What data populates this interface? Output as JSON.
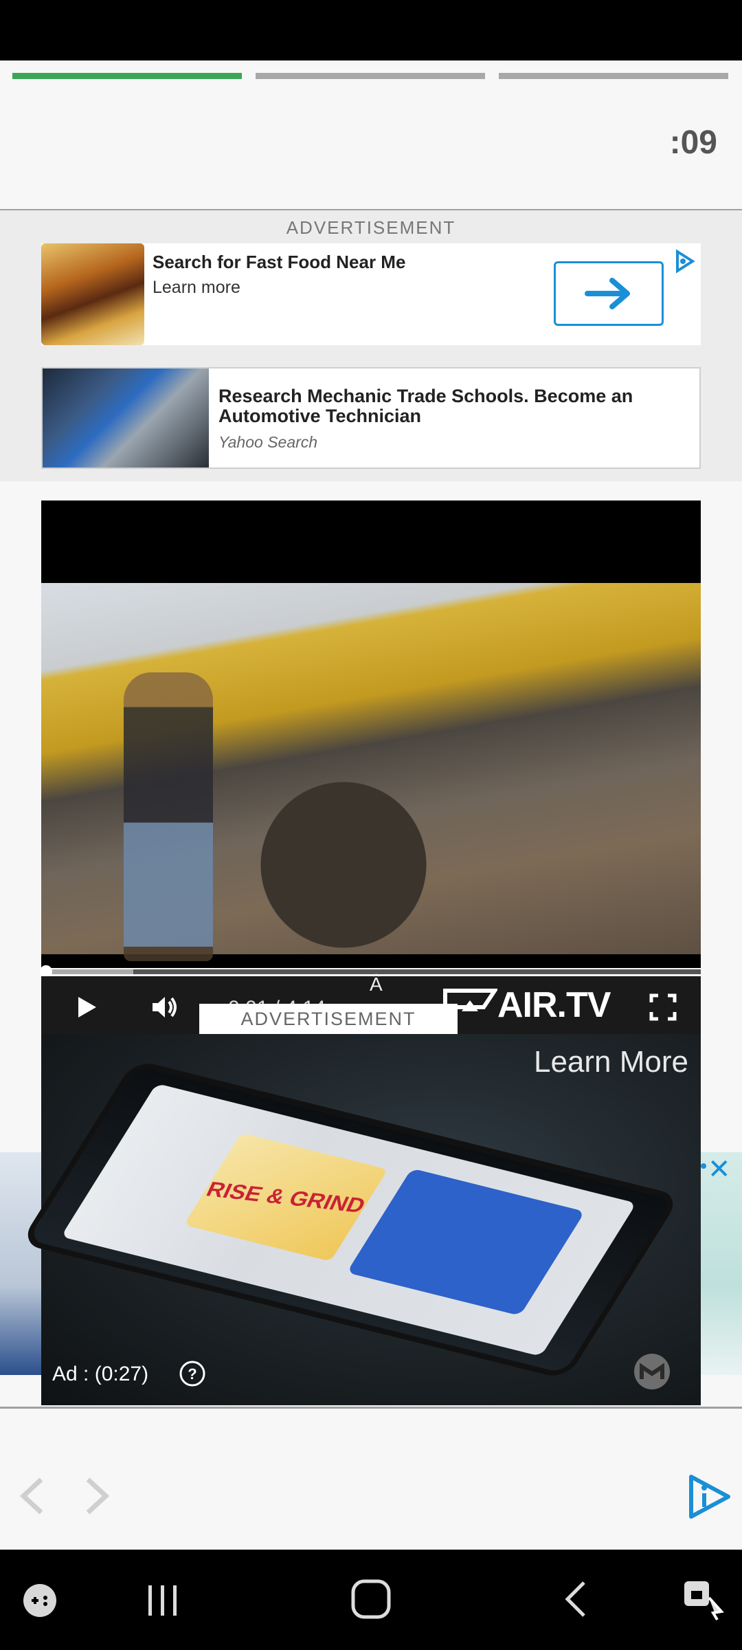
{
  "story": {
    "timer": ":09",
    "progress": [
      1.0,
      0.0,
      0.0
    ]
  },
  "ads": {
    "label": "ADVERTISEMENT",
    "card1": {
      "title": "Search for Fast Food Near Me",
      "subtitle": "Learn more"
    },
    "card2": {
      "title": "Research Mechanic Trade Schools. Become an Automotive Technician",
      "source": "Yahoo Search"
    }
  },
  "video": {
    "time": "0:01 / 4:14",
    "caret": "Â",
    "brand": "AIR.TV",
    "progress": 0.14
  },
  "overlay_ad": {
    "label": "ADVERTISEMENT",
    "learn_more": "Learn More",
    "rise_text": "RISE & GRIND",
    "ad_timer": "Ad : (0:27)"
  },
  "icons": {
    "adchoices": "adchoices-icon",
    "close": "close-icon",
    "play": "play-icon",
    "volume": "volume-icon",
    "fullscreen": "fullscreen-icon",
    "help": "help-icon",
    "prev": "chevron-left-icon",
    "next": "chevron-right-icon",
    "brand": "brand-i-icon"
  },
  "colors": {
    "progress_active": "#3aa757",
    "accent": "#1a8fd6"
  }
}
